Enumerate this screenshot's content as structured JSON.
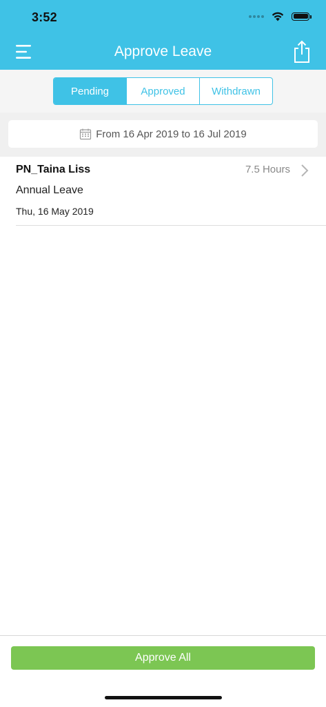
{
  "status_bar": {
    "time": "3:52"
  },
  "nav": {
    "title": "Approve Leave"
  },
  "tabs": [
    {
      "label": "Pending",
      "active": true
    },
    {
      "label": "Approved",
      "active": false
    },
    {
      "label": "Withdrawn",
      "active": false
    }
  ],
  "date_filter": {
    "label": "From 16 Apr 2019 to 16 Jul 2019"
  },
  "leave_requests": [
    {
      "employee": "PN_Taina Liss",
      "hours": "7.5 Hours",
      "type": "Annual Leave",
      "date": "Thu, 16 May 2019"
    }
  ],
  "footer": {
    "approve_all_label": "Approve All"
  },
  "colors": {
    "header": "#3fc2e6",
    "approve_button": "#7cc653"
  },
  "icons": {
    "menu": "menu-icon",
    "share": "share-icon",
    "calendar": "calendar-icon",
    "chevron": "chevron-right-icon"
  }
}
